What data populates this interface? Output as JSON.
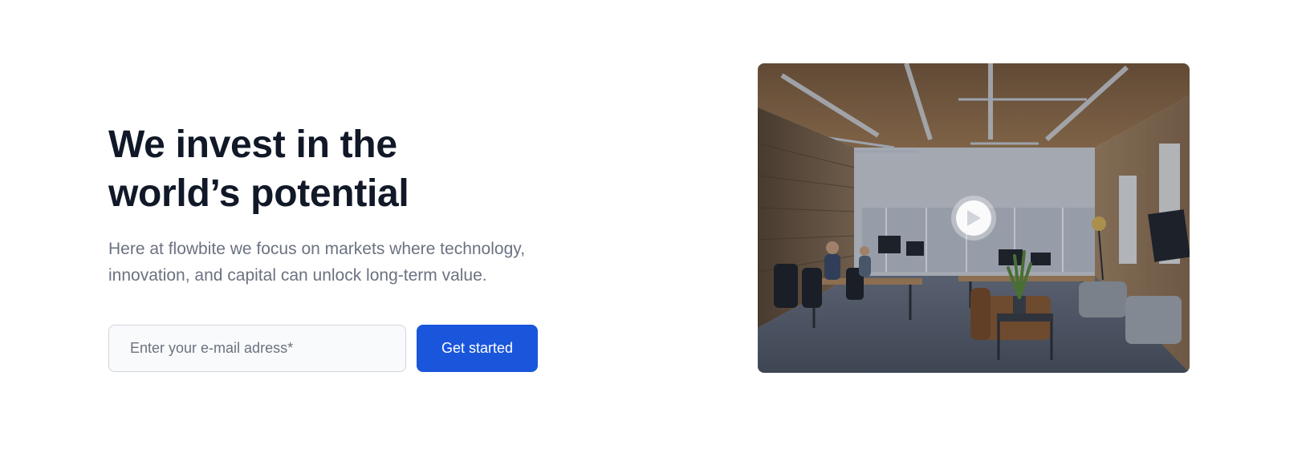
{
  "hero": {
    "title_line1": "We invest in the",
    "title_line2": "world’s potential",
    "subtitle": "Here at flowbite we focus on markets where technology, innovation, and capital can unlock long-term value.",
    "email_placeholder": "Enter your e-mail adress*",
    "cta_label": "Get started"
  },
  "media": {
    "image_subject": "office-interior",
    "play_icon": "play-icon"
  },
  "colors": {
    "heading": "#111827",
    "body_text": "#6b7280",
    "primary": "#1a56db",
    "input_bg": "#f9fafb",
    "input_border": "#d1d5db"
  }
}
